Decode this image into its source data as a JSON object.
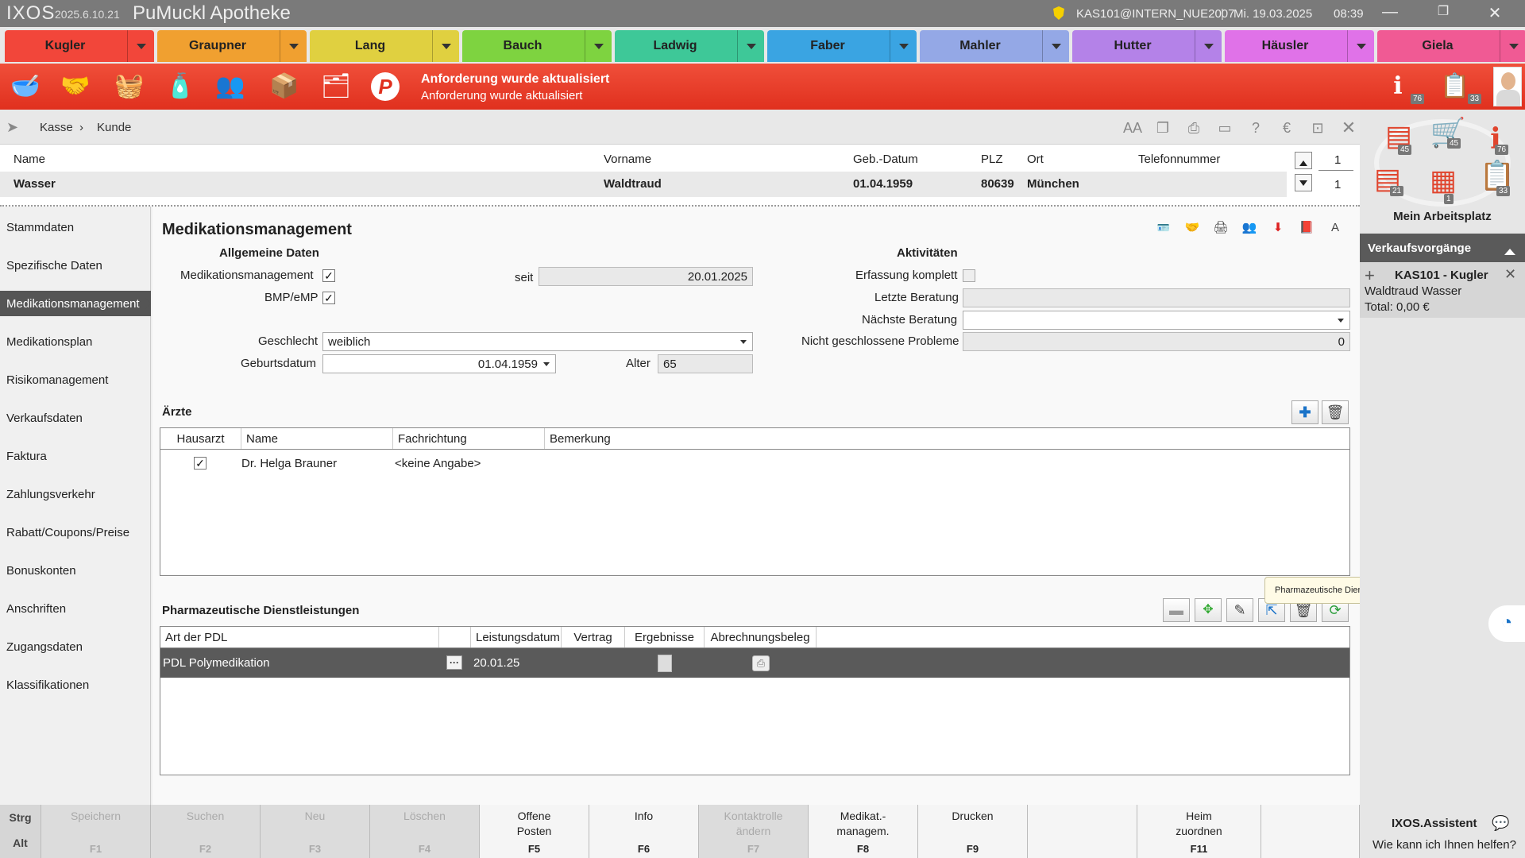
{
  "titlebar": {
    "app": "IXOS",
    "version": "2025.6.10.21",
    "pharmacy": "PuMuckl Apotheke",
    "user": "KAS101@INTERN_NUE2007",
    "separator": "|",
    "date": "Mi. 19.03.2025",
    "time": "08:39"
  },
  "tabs": [
    {
      "label": "Kugler",
      "color": "#f2463a"
    },
    {
      "label": "Graupner",
      "color": "#f0a030"
    },
    {
      "label": "Lang",
      "color": "#e0d040"
    },
    {
      "label": "Bauch",
      "color": "#7ed340"
    },
    {
      "label": "Ladwig",
      "color": "#3ec898"
    },
    {
      "label": "Faber",
      "color": "#3aa4e2"
    },
    {
      "label": "Mahler",
      "color": "#94a8e6"
    },
    {
      "label": "Hutter",
      "color": "#b482e8"
    },
    {
      "label": "Häusler",
      "color": "#e072e8"
    },
    {
      "label": "Giela",
      "color": "#f05a94"
    }
  ],
  "notification": {
    "title": "Anforderung wurde aktualisiert",
    "text": "Anforderung wurde aktualisiert"
  },
  "toolbar_badges": {
    "info": "76",
    "tasks": "33"
  },
  "breadcrumb": {
    "root": "Kasse",
    "sep": "›",
    "current": "Kunde"
  },
  "customer": {
    "headers": {
      "name": "Name",
      "vorname": "Vorname",
      "geb": "Geb.-Datum",
      "plz": "PLZ",
      "ort": "Ort",
      "tel": "Telefonnummer"
    },
    "name": "Wasser",
    "vorname": "Waldtraud",
    "geb": "01.04.1959",
    "plz": "80639",
    "ort": "München",
    "tel": "",
    "counter_top": "1",
    "counter_bottom": "1"
  },
  "sidebar": [
    {
      "label": "Stammdaten"
    },
    {
      "label": "Spezifische Daten"
    },
    {
      "label": "Medikationsmanagement",
      "active": true
    },
    {
      "label": "Medikationsplan"
    },
    {
      "label": "Risikomanagement"
    },
    {
      "label": "Verkaufsdaten"
    },
    {
      "label": "Faktura"
    },
    {
      "label": "Zahlungsverkehr"
    },
    {
      "label": "Rabatt/Coupons/Preise"
    },
    {
      "label": "Bonuskonten"
    },
    {
      "label": "Anschriften"
    },
    {
      "label": "Zugangsdaten"
    },
    {
      "label": "Klassifikationen"
    }
  ],
  "main": {
    "title": "Medikationsmanagement",
    "allgemein": {
      "heading": "Allgemeine Daten",
      "medman_label": "Medikationsmanagement",
      "medman_checked": true,
      "bmp_label": "BMP/eMP",
      "bmp_checked": true,
      "seit_label": "seit",
      "seit_value": "20.01.2025",
      "geschlecht_label": "Geschlecht",
      "geschlecht_value": "weiblich",
      "geburtsdatum_label": "Geburtsdatum",
      "geburtsdatum_value": "01.04.1959",
      "alter_label": "Alter",
      "alter_value": "65"
    },
    "aktivitaeten": {
      "heading": "Aktivitäten",
      "erfassung_label": "Erfassung komplett",
      "erfassung_checked": false,
      "letzte_label": "Letzte Beratung",
      "letzte_value": "",
      "naechste_label": "Nächste Beratung",
      "naechste_value": "",
      "probleme_label": "Nicht geschlossene Probleme",
      "probleme_value": "0"
    },
    "aerzte": {
      "heading": "Ärzte",
      "columns": [
        "Hausarzt",
        "Name",
        "Fachrichtung",
        "Bemerkung"
      ],
      "rows": [
        {
          "hausarzt": true,
          "name": "Dr. Helga Brauner",
          "fachrichtung": "<keine Angabe>",
          "bemerkung": ""
        }
      ]
    },
    "pdl": {
      "heading": "Pharmazeutische Dienstleistungen",
      "tooltip": "Pharmazeutische Dienstleistung hinzufügen",
      "columns": [
        "Art der PDL",
        "",
        "Leistungsdatum",
        "Vertrag",
        "Ergebnisse",
        "Abrechnungsbeleg"
      ],
      "rows": [
        {
          "art": "PDL Polymedikation",
          "more": "···",
          "datum": "20.01.25",
          "vertrag": ""
        }
      ]
    }
  },
  "rpanel": {
    "workplace": "Mein Arbeitsplatz",
    "badges": [
      "45",
      "45",
      "76",
      "21",
      "1",
      "33"
    ],
    "vorgaenge_title": "Verkaufsvorgänge",
    "vorgang_title": "KAS101 - Kugler",
    "vorgang_customer": "Waldtraud Wasser",
    "vorgang_total": "Total: 0,00 €",
    "assistant_title": "IXOS.Assistent",
    "assistant_text": "Wie kann ich Ihnen helfen?"
  },
  "fkeys": {
    "mod1": "Strg",
    "mod2": "Alt",
    "keys": [
      {
        "label": "Speichern",
        "key": "F1",
        "enabled": false
      },
      {
        "label": "Suchen",
        "key": "F2",
        "enabled": false
      },
      {
        "label": "Neu",
        "key": "F3",
        "enabled": false
      },
      {
        "label": "Löschen",
        "key": "F4",
        "enabled": false
      },
      {
        "label": "Offene\nPosten",
        "key": "F5",
        "enabled": true
      },
      {
        "label": "Info",
        "key": "F6",
        "enabled": true
      },
      {
        "label": "Kontaktrolle\nändern",
        "key": "F7",
        "enabled": false
      },
      {
        "label": "Medikat.-\nmanagem.",
        "key": "F8",
        "enabled": true
      },
      {
        "label": "Drucken",
        "key": "F9",
        "enabled": true
      },
      {
        "label": "",
        "key": "",
        "enabled": true
      },
      {
        "label": "Heim\nzuordnen",
        "key": "F11",
        "enabled": true
      }
    ]
  }
}
